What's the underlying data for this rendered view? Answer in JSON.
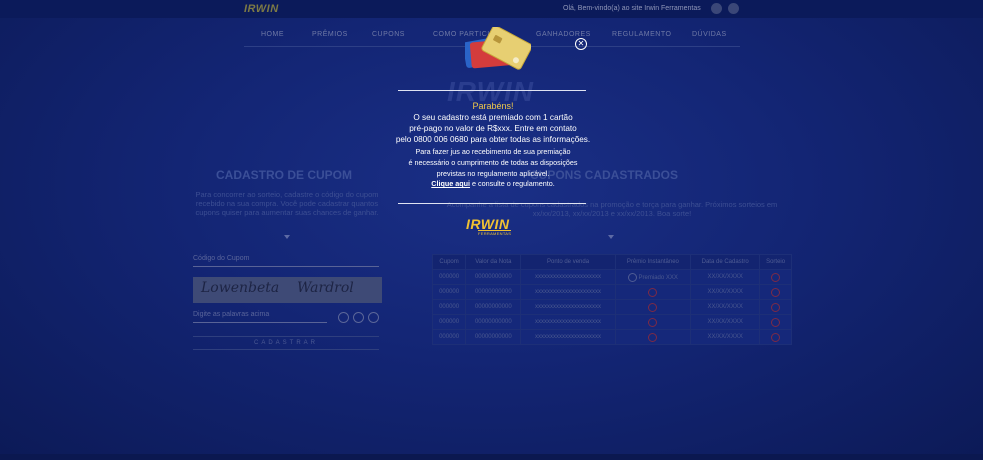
{
  "header": {
    "logo": "IRWIN",
    "welcome": "Olá, Bem-vindo(a) ao site Irwin Ferramentas"
  },
  "nav": {
    "items": [
      "HOME",
      "PRÊMIOS",
      "CUPONS",
      "COMO PARTICIPAR",
      "GANHADORES",
      "REGULAMENTO",
      "DÚVIDAS"
    ]
  },
  "left": {
    "title": "CADASTRO DE CUPOM",
    "text": "Para concorrer ao sorteio, cadastre o código do cupom recebido na sua compra. Você pode cadastrar quantos cupons quiser para aumentar suas chances de ganhar.",
    "coupon_placeholder": "Código do Cupom",
    "captcha_words": [
      "Lowenbeta",
      "Wardrol"
    ],
    "captcha_placeholder": "Digite as palavras acima",
    "send_label": "CADASTRAR"
  },
  "right": {
    "title": "CUPONS CADASTRADOS",
    "text": "Acompanhe a lista de cupons cadastrados na promoção e torça para ganhar. Próximos sorteios em xx/xx/2013, xx/xx/2013 e xx/xx/2013. Boa sorte!",
    "columns": [
      "Cupom",
      "Valor da Nota",
      "Ponto de venda",
      "Prêmio Instantâneo",
      "Data de Cadastro",
      "Sorteio"
    ],
    "rows": [
      [
        "000000",
        "00000000000",
        "xxxxxxxxxxxxxxxxxxxxxx",
        "Premiado XXX",
        "XX/XX/XXXX"
      ],
      [
        "000000",
        "00000000000",
        "xxxxxxxxxxxxxxxxxxxxxx",
        "",
        "XX/XX/XXXX"
      ],
      [
        "000000",
        "00000000000",
        "xxxxxxxxxxxxxxxxxxxxxx",
        "",
        "XX/XX/XXXX"
      ],
      [
        "000000",
        "00000000000",
        "xxxxxxxxxxxxxxxxxxxxxx",
        "",
        "XX/XX/XXXX"
      ],
      [
        "000000",
        "00000000000",
        "xxxxxxxxxxxxxxxxxxxxxx",
        "",
        "XX/XX/XXXX"
      ]
    ]
  },
  "modal": {
    "congrats": "Parabéns!",
    "line1": "O seu cadastro está premiado com 1 cartão",
    "line2": "pré-pago no valor de R$xxx. Entre em contato",
    "line3": "pelo 0800 006 0680 para obter todas as informações.",
    "sub1": "Para fazer jus ao recebimento de sua premiação",
    "sub2": "é necessário o cumprimento de todas as disposições",
    "sub3": "previstas no regulamento aplicável.",
    "link": "Clique aqui",
    "sub4": " e consulte o regulamento.",
    "logo_word": "IRWIN",
    "logo_sub": "FERRAMENTAS",
    "close_icon": "close-circle-icon"
  },
  "colors": {
    "accent_yellow": "#f0c84a",
    "overlay_blue": "#132574"
  }
}
